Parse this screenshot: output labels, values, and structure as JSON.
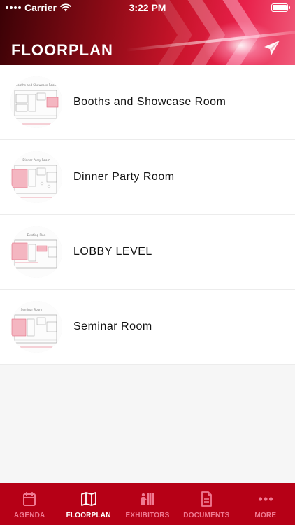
{
  "status_bar": {
    "carrier": "Carrier",
    "time": "3:22 PM"
  },
  "header": {
    "title": "FLOORPLAN",
    "action_icon": "send-icon"
  },
  "floorplans": [
    {
      "label": "Booths and Showcase Room",
      "thumb_caption": "Booths and Showcase Room"
    },
    {
      "label": "Dinner Party Room",
      "thumb_caption": "Dinner Party Room"
    },
    {
      "label": "LOBBY LEVEL",
      "thumb_caption": "Existing Plan"
    },
    {
      "label": "Seminar Room",
      "thumb_caption": "Seminar Room"
    }
  ],
  "tabbar": {
    "active": "floorplan",
    "tabs": [
      {
        "id": "agenda",
        "label": "AGENDA",
        "icon": "calendar-icon"
      },
      {
        "id": "floorplan",
        "label": "FLOORPLAN",
        "icon": "map-icon"
      },
      {
        "id": "exhibitors",
        "label": "EXHIBITORS",
        "icon": "exhibitors-icon"
      },
      {
        "id": "documents",
        "label": "DOCUMENTS",
        "icon": "document-icon"
      },
      {
        "id": "more",
        "label": "MORE",
        "icon": "more-icon"
      }
    ]
  },
  "colors": {
    "tabbar_bg": "#b60016",
    "tab_inactive": "#f07a92",
    "tab_active": "#ffffff"
  }
}
